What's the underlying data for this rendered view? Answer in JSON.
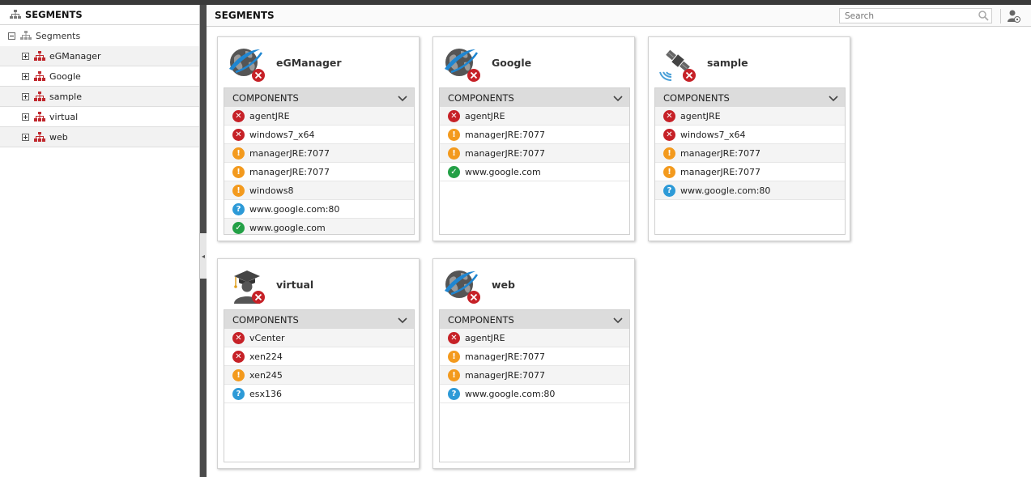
{
  "left_panel": {
    "title": "SEGMENTS",
    "root_label": "Segments",
    "items": [
      "eGManager",
      "Google",
      "sample",
      "virtual",
      "web"
    ]
  },
  "main": {
    "title": "SEGMENTS",
    "search_placeholder": "Search"
  },
  "colors": {
    "critical": "#c62127",
    "major": "#f39a1e",
    "unknown": "#2d9ad7",
    "ok": "#23a046",
    "segment_icon": "#c0282d"
  },
  "components_label": "COMPONENTS",
  "cards": [
    {
      "name": "eGManager",
      "icon": "globe-icon",
      "components": [
        {
          "label": "agentJRE",
          "status": "critical"
        },
        {
          "label": "windows7_x64",
          "status": "critical"
        },
        {
          "label": "managerJRE:7077",
          "status": "major"
        },
        {
          "label": "managerJRE:7077",
          "status": "major"
        },
        {
          "label": "windows8",
          "status": "major"
        },
        {
          "label": "www.google.com:80",
          "status": "unknown"
        },
        {
          "label": "www.google.com",
          "status": "ok"
        }
      ]
    },
    {
      "name": "Google",
      "icon": "globe-icon",
      "components": [
        {
          "label": "agentJRE",
          "status": "critical"
        },
        {
          "label": "managerJRE:7077",
          "status": "major"
        },
        {
          "label": "managerJRE:7077",
          "status": "major"
        },
        {
          "label": "www.google.com",
          "status": "ok"
        }
      ]
    },
    {
      "name": "sample",
      "icon": "satellite-icon",
      "components": [
        {
          "label": "agentJRE",
          "status": "critical"
        },
        {
          "label": "windows7_x64",
          "status": "critical"
        },
        {
          "label": "managerJRE:7077",
          "status": "major"
        },
        {
          "label": "managerJRE:7077",
          "status": "major"
        },
        {
          "label": "www.google.com:80",
          "status": "unknown"
        }
      ]
    },
    {
      "name": "virtual",
      "icon": "graduate-icon",
      "components": [
        {
          "label": "vCenter",
          "status": "critical"
        },
        {
          "label": "xen224",
          "status": "critical"
        },
        {
          "label": "xen245",
          "status": "major"
        },
        {
          "label": "esx136",
          "status": "unknown"
        }
      ]
    },
    {
      "name": "web",
      "icon": "globe-icon",
      "components": [
        {
          "label": "agentJRE",
          "status": "critical"
        },
        {
          "label": "managerJRE:7077",
          "status": "major"
        },
        {
          "label": "managerJRE:7077",
          "status": "major"
        },
        {
          "label": "www.google.com:80",
          "status": "unknown"
        }
      ]
    }
  ]
}
